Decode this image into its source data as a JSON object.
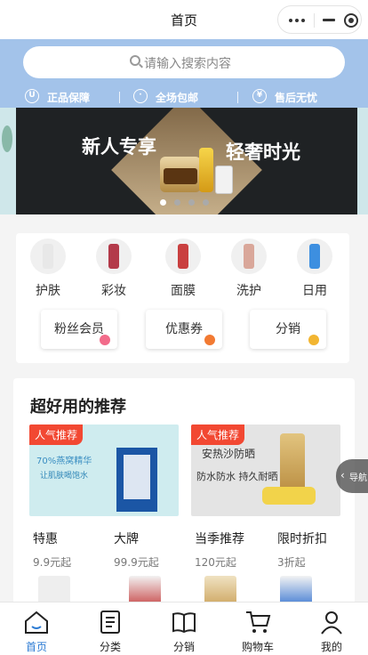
{
  "navbar": {
    "title": "首页"
  },
  "search": {
    "placeholder": "请输入搜索内容"
  },
  "assurances": [
    {
      "label": "正品保障",
      "icon": "shield-icon"
    },
    {
      "label": "全场包邮",
      "icon": "truck-icon"
    },
    {
      "label": "售后无忧",
      "icon": "refresh-icon"
    }
  ],
  "banner": {
    "text_left": "新人专享",
    "text_right": "轻奢时光",
    "active_index": 0,
    "count": 4
  },
  "categories": [
    {
      "label": "护肤"
    },
    {
      "label": "彩妆"
    },
    {
      "label": "面膜"
    },
    {
      "label": "洗护"
    },
    {
      "label": "日用"
    }
  ],
  "chips": [
    {
      "label": "粉丝会员"
    },
    {
      "label": "优惠券"
    },
    {
      "label": "分销"
    }
  ],
  "recommend": {
    "title": "超好用的推荐",
    "promos": [
      {
        "tag": "人气推荐",
        "headline": "70%燕窝精华",
        "subline": "让肌肤喝饱水"
      },
      {
        "tag": "人气推荐",
        "headline": "安热沙防晒",
        "subline": "防水防水 持久耐晒"
      }
    ],
    "items": [
      {
        "title": "特惠",
        "price": "9.9元起"
      },
      {
        "title": "大牌",
        "price": "99.9元起"
      },
      {
        "title": "当季推荐",
        "price": "120元起"
      },
      {
        "title": "限时折扣",
        "price": "3折起"
      }
    ]
  },
  "side_tab": {
    "label": "导航"
  },
  "tabbar": [
    {
      "label": "首页",
      "active": true
    },
    {
      "label": "分类",
      "active": false
    },
    {
      "label": "分销",
      "active": false
    },
    {
      "label": "购物车",
      "active": false
    },
    {
      "label": "我的",
      "active": false
    }
  ],
  "colors": {
    "accent": "#2c7bd3",
    "band": "#a3c3ea",
    "tag": "#f24832"
  }
}
